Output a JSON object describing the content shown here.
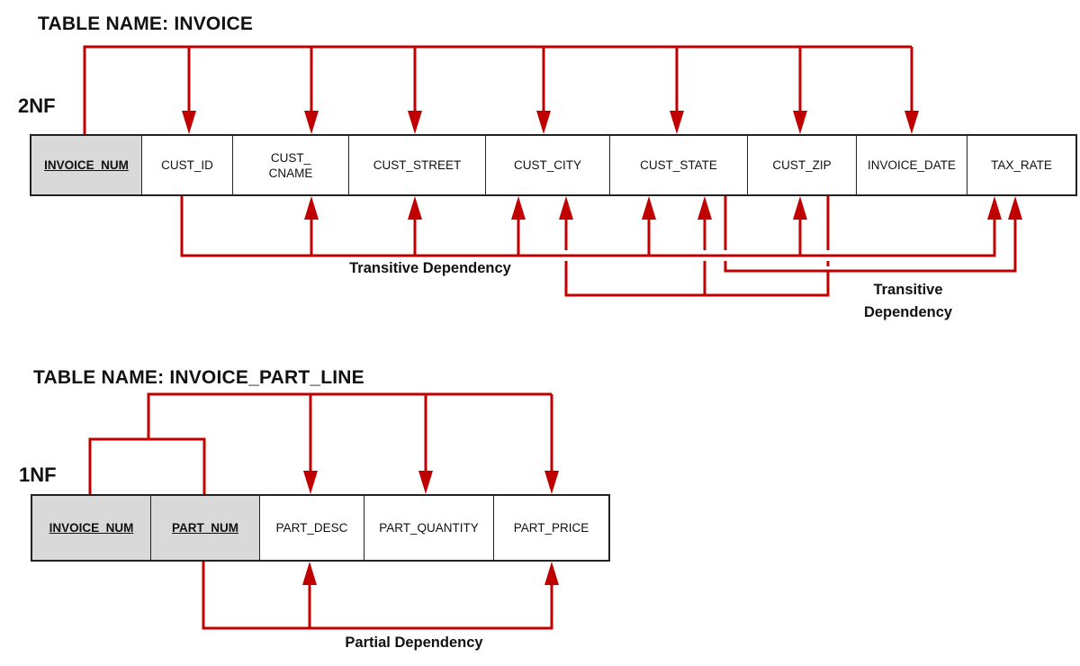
{
  "colors": {
    "arrow": "#c00000",
    "key_fill": "#d9d9d9",
    "border": "#222222"
  },
  "invoice_table": {
    "title": "TABLE NAME:  INVOICE",
    "normal_form": "2NF",
    "columns": [
      {
        "name": "INVOICE_NUM",
        "key": true
      },
      {
        "name": "CUST_ID",
        "key": false
      },
      {
        "name": "CUST_\nCNAME",
        "key": false
      },
      {
        "name": "CUST_STREET",
        "key": false
      },
      {
        "name": "CUST_CITY",
        "key": false
      },
      {
        "name": "CUST_STATE",
        "key": false
      },
      {
        "name": "CUST_ZIP",
        "key": false
      },
      {
        "name": "INVOICE_DATE",
        "key": false
      },
      {
        "name": "TAX_RATE",
        "key": false
      }
    ],
    "dependencies": [
      {
        "type": "functional",
        "determinant": [
          "INVOICE_NUM"
        ],
        "dependents": [
          "CUST_ID",
          "CUST_CNAME",
          "CUST_STREET",
          "CUST_CITY",
          "CUST_STATE",
          "CUST_ZIP",
          "INVOICE_DATE"
        ]
      },
      {
        "type": "transitive",
        "label": "Transitive Dependency",
        "determinant": [
          "CUST_ID"
        ],
        "dependents": [
          "CUST_CNAME",
          "CUST_STREET",
          "CUST_CITY",
          "CUST_STATE",
          "CUST_ZIP",
          "TAX_RATE"
        ]
      },
      {
        "type": "transitive",
        "label": "Transitive Dependency",
        "determinant": [
          "CUST_ZIP"
        ],
        "dependents": [
          "CUST_CITY",
          "CUST_STATE"
        ]
      },
      {
        "type": "transitive",
        "label": "Transitive Dependency",
        "determinant": [
          "CUST_STATE"
        ],
        "dependents": [
          "TAX_RATE"
        ]
      }
    ],
    "labels": {
      "transitive_main": "Transitive Dependency",
      "transitive_right": "Transitive\nDependency"
    }
  },
  "invoice_part_line_table": {
    "title": "TABLE NAME:  INVOICE_PART_LINE",
    "normal_form": "1NF",
    "columns": [
      {
        "name": "INVOICE_NUM",
        "key": true
      },
      {
        "name": "PART_NUM",
        "key": true
      },
      {
        "name": "PART_DESC",
        "key": false
      },
      {
        "name": "PART_QUANTITY",
        "key": false
      },
      {
        "name": "PART_PRICE",
        "key": false
      }
    ],
    "dependencies": [
      {
        "type": "functional",
        "determinant": [
          "INVOICE_NUM",
          "PART_NUM"
        ],
        "dependents": [
          "PART_DESC",
          "PART_QUANTITY",
          "PART_PRICE"
        ]
      },
      {
        "type": "partial",
        "label": "Partial Dependency",
        "determinant": [
          "PART_NUM"
        ],
        "dependents": [
          "PART_DESC",
          "PART_PRICE"
        ]
      }
    ],
    "labels": {
      "partial": "Partial Dependency"
    }
  }
}
